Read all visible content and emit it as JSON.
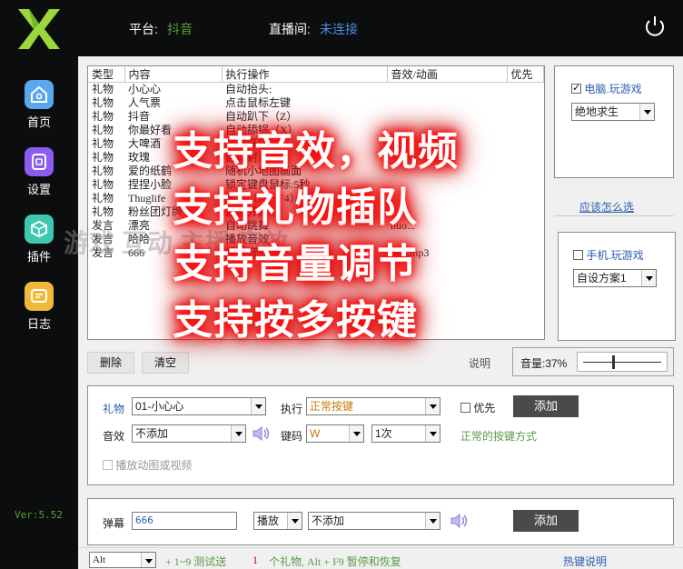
{
  "sidebar": {
    "items": [
      {
        "label": "首页",
        "icon": "home-icon",
        "color": "#5aa7f0"
      },
      {
        "label": "设置",
        "icon": "settings-icon",
        "color": "#8a5cf0"
      },
      {
        "label": "插件",
        "icon": "plugin-icon",
        "color": "#3ec8b0"
      },
      {
        "label": "日志",
        "icon": "log-icon",
        "color": "#f0b93a"
      }
    ],
    "version": "Ver:5.52"
  },
  "header": {
    "platform_label": "平台:",
    "platform_value": "抖音",
    "room_label": "直播间:",
    "room_value": "未连接"
  },
  "list": {
    "columns": [
      "类型",
      "内容",
      "执行操作",
      "音效/动画",
      "优先"
    ],
    "rows": [
      [
        "礼物",
        "小心心",
        "自动抬头:",
        "",
        ""
      ],
      [
        "礼物",
        "人气票",
        "点击鼠标左键",
        "",
        ""
      ],
      [
        "礼物",
        "抖音",
        "自动趴下（Z）",
        "",
        ""
      ],
      [
        "礼物",
        "你最好看",
        "自动舔锅（X）",
        "",
        ""
      ],
      [
        "礼物",
        "大啤酒",
        "自动开镜",
        "",
        ""
      ],
      [
        "礼物",
        "玫瑰",
        "自动射击",
        "",
        ""
      ],
      [
        "礼物",
        "爱的纸鹤",
        "随机小地图画面",
        "",
        ""
      ],
      [
        "礼物",
        "捏捏小脸",
        "锁定键盘鼠标:5秒",
        "",
        ""
      ],
      [
        "礼物",
        "Thuglife",
        "大跳（Alt+F4）",
        "",
        ""
      ],
      [
        "礼物",
        "粉丝团灯牌",
        "自动开火:3",
        "",
        ""
      ],
      [
        "发言",
        "漂亮",
        "自动跳舞",
        "huo...",
        ""
      ],
      [
        "发言",
        "哈哈",
        "播放音效",
        "",
        ""
      ],
      [
        "发言",
        "666",
        "播放音效",
        "666.mp3",
        ""
      ]
    ]
  },
  "pc_panel": {
    "label": "电脑.玩游戏",
    "checked": true,
    "game": "绝地求生"
  },
  "help_link": "应该怎么选",
  "mobile_panel": {
    "label": "手机.玩游戏",
    "checked": false,
    "scheme": "自设方案1"
  },
  "toolbar": {
    "delete": "删除",
    "clear": "清空",
    "extra": "说明",
    "volume_label": "音量:37%",
    "volume": 0.37
  },
  "gift_form": {
    "gift_label": "礼物",
    "gift_value": "01-小心心",
    "exec_label": "执行",
    "exec_value": "正常按键",
    "priority_label": "优先",
    "add": "添加",
    "sound_label": "音效",
    "sound_value": "不添加",
    "key_label": "键码",
    "key_value": "W",
    "times_value": "1次",
    "hint": "正常的按键方式",
    "play_media_label": "播放动图或视频"
  },
  "danmu_form": {
    "label": "弹幕",
    "input_value": "666",
    "action_value": "播放",
    "sound_value": "不添加",
    "add": "添加"
  },
  "statusbar": {
    "key_value": "Alt",
    "text_a": "+ 1~9 测试送",
    "count": "1",
    "text_b": "个礼物, Alt + F9 暂停和恢复",
    "hotkey_link": "热键说明"
  },
  "overlay": [
    "支持音效，视频",
    "支持礼物插队",
    "支持音量调节",
    "支持按多按键"
  ],
  "watermark": "游戏 互动 主播 音效"
}
